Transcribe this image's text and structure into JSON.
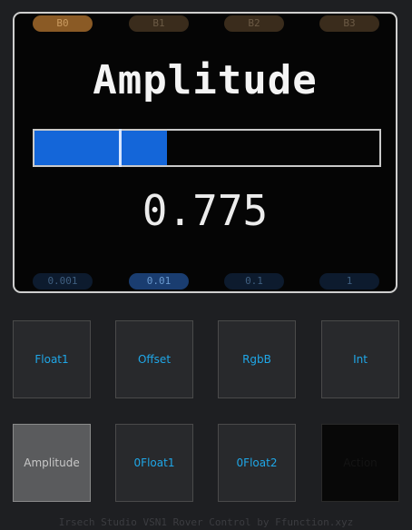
{
  "banks": [
    {
      "label": "B0",
      "active": true
    },
    {
      "label": "B1",
      "active": false
    },
    {
      "label": "B2",
      "active": false
    },
    {
      "label": "B3",
      "active": false
    }
  ],
  "display": {
    "title": "Amplitude",
    "value": "0.775",
    "fill_fraction": 0.385,
    "marker_fraction": 0.245,
    "bar_color": "#1466d9"
  },
  "steps": [
    {
      "label": "0.001",
      "active": false
    },
    {
      "label": "0.01",
      "active": true
    },
    {
      "label": "0.1",
      "active": false
    },
    {
      "label": "1",
      "active": false
    }
  ],
  "pads": [
    {
      "label": "Float1",
      "state": "normal"
    },
    {
      "label": "Offset",
      "state": "normal"
    },
    {
      "label": "RgbB",
      "state": "normal"
    },
    {
      "label": "Int",
      "state": "normal"
    },
    {
      "label": "Amplitude",
      "state": "active"
    },
    {
      "label": "0Float1",
      "state": "normal"
    },
    {
      "label": "0Float2",
      "state": "normal"
    },
    {
      "label": "Action",
      "state": "empty"
    }
  ],
  "footer": "Irsech Studio VSN1 Rover Control by Ffunction.xyz"
}
